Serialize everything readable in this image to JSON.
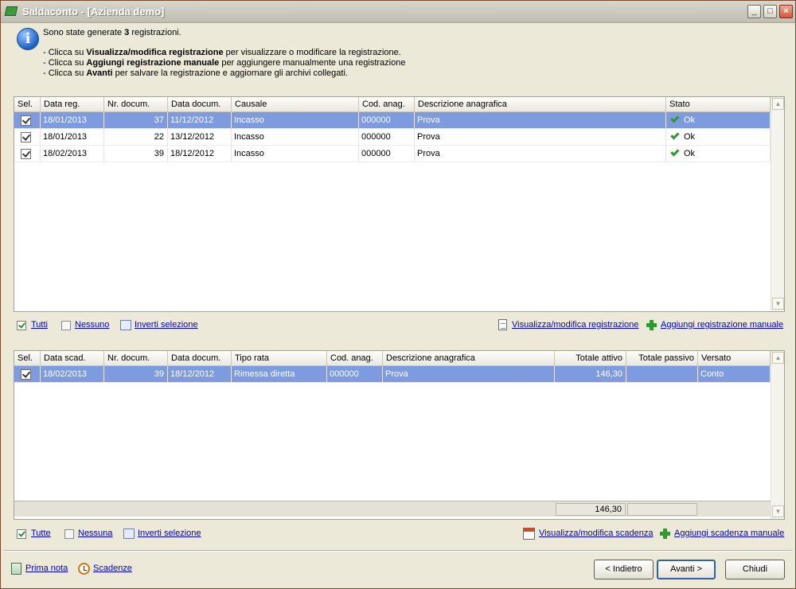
{
  "window": {
    "title": "Saldaconto - [Azienda demo]",
    "minimize": "_",
    "maximize": "□",
    "close": "×"
  },
  "info": {
    "line1_pre": "Sono state generate ",
    "line1_bold": "3",
    "line1_post": " registrazioni.",
    "line2_pre": "- Clicca su ",
    "line2_bold": "Visualizza/modifica registrazione",
    "line2_post": " per visualizzare o modificare la registrazione.",
    "line3_pre": "- Clicca su ",
    "line3_bold": "Aggiungi registrazione manuale",
    "line3_post": " per aggiungere manualmente una registrazione",
    "line4_pre": "- Clicca su ",
    "line4_bold": "Avanti",
    "line4_post": " per salvare la registrazione e aggiornare gli archivi collegati."
  },
  "registrations": {
    "headers": [
      "Sel.",
      "Data reg.",
      "Nr. docum.",
      "Data docum.",
      "Causale",
      "Cod. anag.",
      "Descrizione anagrafica",
      "Stato"
    ],
    "rows": [
      {
        "data_reg": "18/01/2013",
        "nr": "37",
        "data_doc": "11/12/2012",
        "causale": "Incasso",
        "cod": "000000",
        "descr": "Prova",
        "stato": "Ok"
      },
      {
        "data_reg": "18/01/2013",
        "nr": "22",
        "data_doc": "13/12/2012",
        "causale": "Incasso",
        "cod": "000000",
        "descr": "Prova",
        "stato": "Ok"
      },
      {
        "data_reg": "18/02/2013",
        "nr": "39",
        "data_doc": "18/12/2012",
        "causale": "Incasso",
        "cod": "000000",
        "descr": "Prova",
        "stato": "Ok"
      }
    ],
    "links": {
      "all": "Tutti",
      "none": "Nessuno",
      "invert": "Inverti selezione",
      "view": "Visualizza/modifica registrazione",
      "add": "Aggiungi registrazione manuale"
    }
  },
  "deadlines": {
    "headers": [
      "Sel.",
      "Data scad.",
      "Nr. docum.",
      "Data docum.",
      "Tipo rata",
      "Cod. anag.",
      "Descrizione anagrafica",
      "Totale attivo",
      "Totale passivo",
      "Versato"
    ],
    "rows": [
      {
        "data_scad": "18/02/2013",
        "nr": "39",
        "data_doc": "18/12/2012",
        "tipo": "Rimessa diretta",
        "cod": "000000",
        "descr": "Prova",
        "attivo": "146,30",
        "passivo": "",
        "versato": "Conto"
      }
    ],
    "totals": {
      "attivo": "146,30",
      "passivo": ""
    },
    "links": {
      "all": "Tutte",
      "none": "Nessuna",
      "invert": "Inverti selezione",
      "view": "Visualizza/modifica scadenza",
      "add": "Aggiungi scadenza manuale"
    }
  },
  "bottom": {
    "prima_nota": "Prima nota",
    "scadenze": "Scadenze",
    "back": "< Indietro",
    "next": "Avanti >",
    "close": "Chiudi"
  }
}
